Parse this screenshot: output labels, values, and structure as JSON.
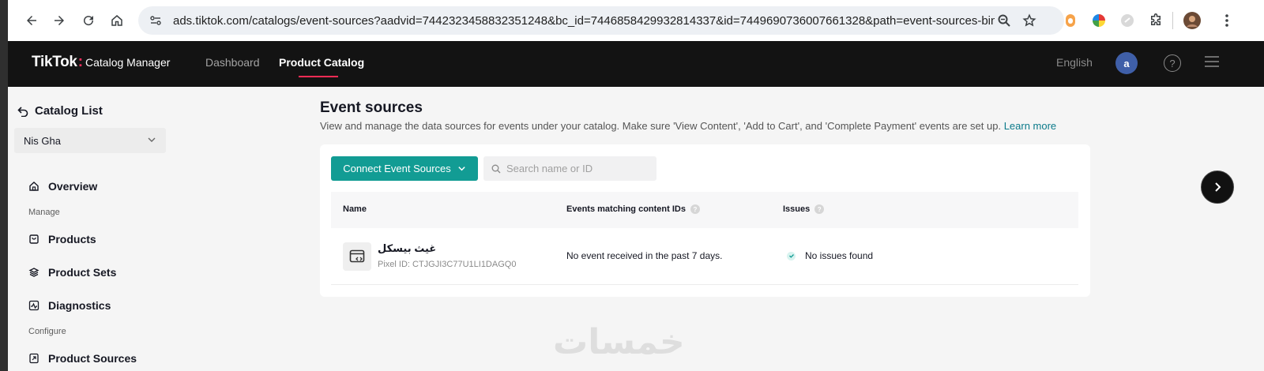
{
  "browser": {
    "url": "ads.tiktok.com/catalogs/event-sources?aadvid=7442323458832351248&bc_id=7446858429932814337&id=7449690736007661328&path=event-sources-binded"
  },
  "header": {
    "brand": "TikTok",
    "subtitle": "Catalog Manager",
    "nav": [
      "Dashboard",
      "Product Catalog"
    ],
    "active_nav": "Product Catalog",
    "language": "English",
    "avatar_letter": "a",
    "help_glyph": "?"
  },
  "sidebar": {
    "back_label": "Catalog List",
    "catalog_name": "Nis Gha",
    "overview": "Overview",
    "section_manage": "Manage",
    "products": "Products",
    "product_sets": "Product Sets",
    "diagnostics": "Diagnostics",
    "section_configure": "Configure",
    "product_sources": "Product Sources"
  },
  "main": {
    "title": "Event sources",
    "description": "View and manage the data sources for events under your catalog. Make sure 'View Content', 'Add to Cart', and 'Complete Payment' events are set up.",
    "learn_more": "Learn more",
    "connect_button": "Connect Event Sources",
    "search_placeholder": "Search name or ID",
    "table": {
      "columns": [
        "Name",
        "Events matching content IDs",
        "Issues"
      ],
      "rows": [
        {
          "name": "غيث بيسكل",
          "pixel_id": "Pixel ID: CTJGJI3C77U1LI1DAGQ0",
          "events": "No event received in the past 7 days.",
          "issues": "No issues found"
        }
      ]
    }
  },
  "watermark": "خمسات",
  "colors": {
    "accent": "#129c94",
    "brand_red": "#fe2c55",
    "header_bg": "#131313",
    "link": "#0b7a8a"
  }
}
